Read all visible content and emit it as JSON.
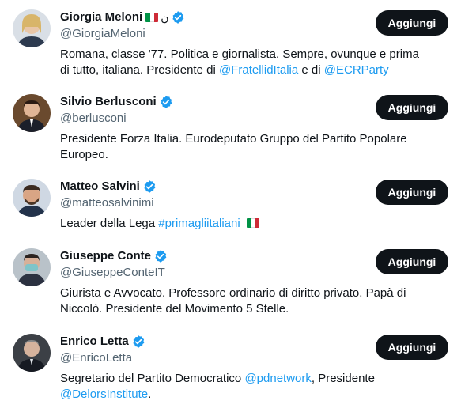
{
  "follow_label": "Aggiungi",
  "link_color": "#1d9bf0",
  "verified_color": "#1d9bf0",
  "users": [
    {
      "name": "Giorgia Meloni",
      "extra_glyph": "ن",
      "handle": "@GiorgiaMeloni",
      "bio": [
        {
          "text": "Romana, classe '77. Politica e giornalista. Sempre, ovunque e prima di tutto, italiana. Presidente di "
        },
        {
          "link": "@FratellidItalia"
        },
        {
          "text": " e di "
        },
        {
          "link": "@ECRParty"
        }
      ]
    },
    {
      "name": "Silvio Berlusconi",
      "handle": "@berlusconi",
      "bio": [
        {
          "text": "Presidente Forza Italia. Eurodeputato Gruppo del Partito Popolare Europeo."
        }
      ]
    },
    {
      "name": "Matteo Salvini",
      "handle": "@matteosalvinimi",
      "bio": [
        {
          "text": "Leader della Lega "
        },
        {
          "link": "#primagliitaliani"
        }
      ]
    },
    {
      "name": "Giuseppe Conte",
      "handle": "@GiuseppeConteIT",
      "bio": [
        {
          "text": "Giurista e Avvocato. Professore ordinario di diritto privato. Papà di Niccolò. Presidente del Movimento 5 Stelle."
        }
      ]
    },
    {
      "name": "Enrico Letta",
      "handle": "@EnricoLetta",
      "bio": [
        {
          "text": "Segretario del Partito Democratico "
        },
        {
          "link": "@pdnetwork"
        },
        {
          "text": ", Presidente "
        },
        {
          "link": "@DelorsInstitute"
        },
        {
          "text": "."
        }
      ]
    }
  ]
}
